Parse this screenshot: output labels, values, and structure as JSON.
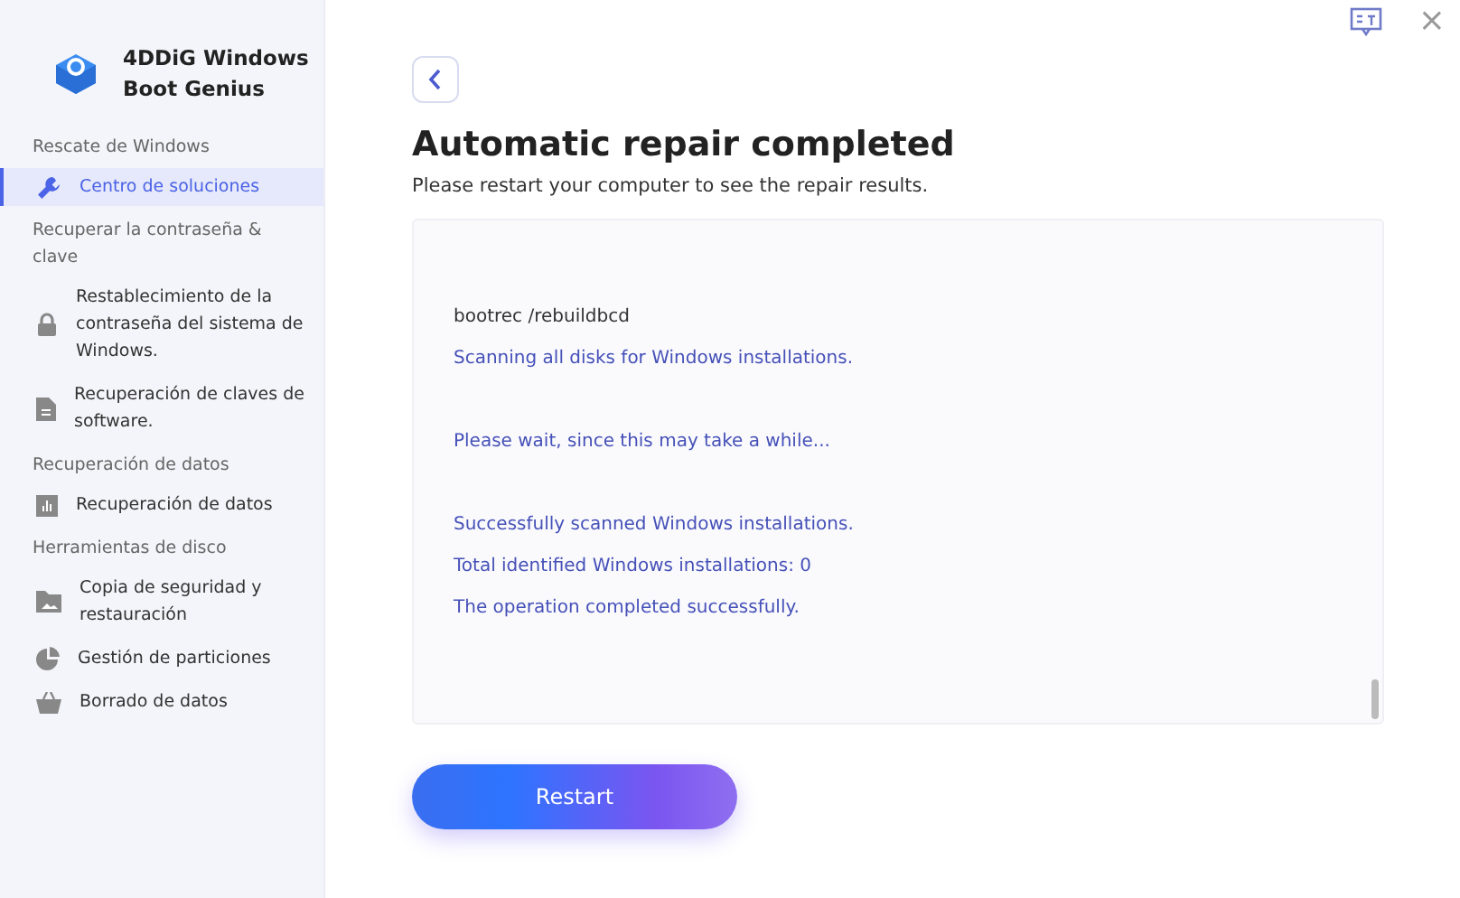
{
  "app": {
    "name": "4DDiG Windows Boot Genius"
  },
  "sidebar": {
    "groups": [
      {
        "title": "Rescate de Windows",
        "items": [
          {
            "label": "Centro de soluciones",
            "selected": true
          }
        ]
      },
      {
        "title": "Recuperar la contraseña & clave",
        "items": [
          {
            "label": "Restablecimiento de la contraseña del sistema de Windows.",
            "selected": false
          },
          {
            "label": "Recuperación de claves de software.",
            "selected": false
          }
        ]
      },
      {
        "title": "Recuperación de datos",
        "items": [
          {
            "label": "Recuperación de datos",
            "selected": false
          }
        ]
      },
      {
        "title": "Herramientas de disco",
        "items": [
          {
            "label": "Copia de seguridad y restauración",
            "selected": false
          },
          {
            "label": "Gestión de particiones",
            "selected": false
          },
          {
            "label": "Borrado de datos",
            "selected": false
          }
        ]
      }
    ]
  },
  "title_bar": {
    "close": "×"
  },
  "main": {
    "title": "Automatic repair completed",
    "subtitle": "Please restart your computer to see the repair results.",
    "log_blocks": [
      {
        "lines": [
          {
            "text": "bootrec /rebuildbcd",
            "kind": "command"
          },
          {
            "text": "Scanning all disks for Windows installations.",
            "kind": "output"
          }
        ]
      },
      {
        "lines": [
          {
            "text": "Please wait, since this may take a while...",
            "kind": "output"
          }
        ]
      },
      {
        "lines": [
          {
            "text": "Successfully scanned Windows installations.",
            "kind": "output"
          },
          {
            "text": "Total identified Windows installations: 0",
            "kind": "output"
          },
          {
            "text": "The operation completed successfully.",
            "kind": "output"
          }
        ]
      }
    ],
    "button": "Restart"
  }
}
